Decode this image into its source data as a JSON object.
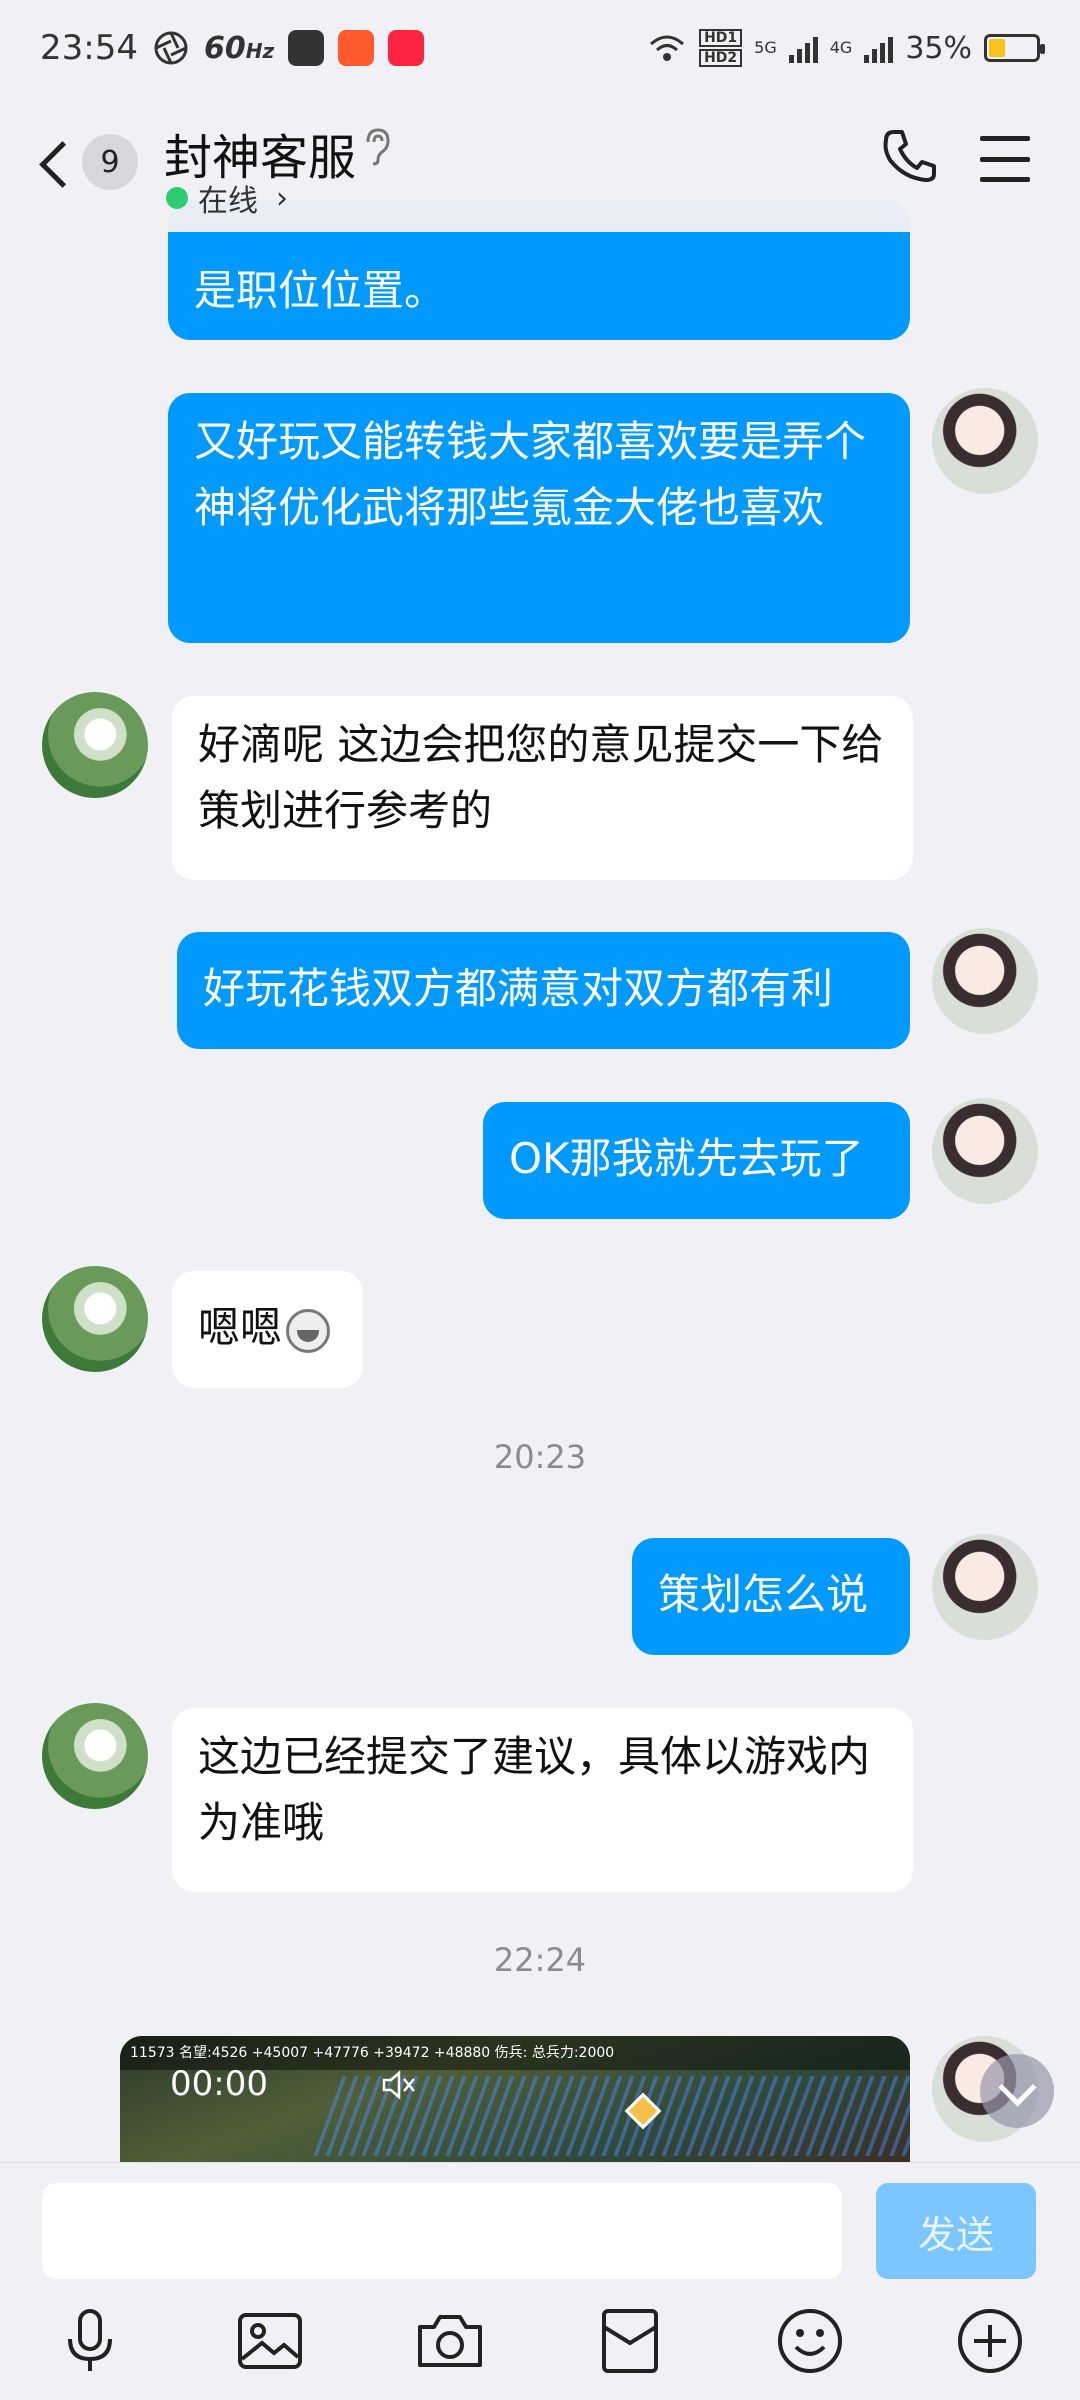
{
  "status_bar": {
    "time": "23:54",
    "refresh_rate": "60",
    "refresh_unit": "Hz",
    "hd1": "HD1",
    "hd2": "HD2",
    "net1": "5G",
    "net2": "4G",
    "battery": "35%",
    "battery_level": 0.35
  },
  "header": {
    "unread_count": "9",
    "title": "封神客服",
    "status": "在线"
  },
  "messages": [
    {
      "side": "out",
      "text_line1": "是职位位置。"
    },
    {
      "side": "out",
      "text": "又好玩又能转钱大家都喜欢要是弄个神将优化武将那些氪金大佬也喜欢"
    },
    {
      "side": "in",
      "text": "好滴呢 这边会把您的意见提交一下给策划进行参考的"
    },
    {
      "side": "out",
      "text": "好玩花钱双方都满意对双方都有利"
    },
    {
      "side": "out",
      "text": "OK那我就先去玩了"
    },
    {
      "side": "in",
      "text": "嗯嗯"
    },
    {
      "side": "time",
      "text": "20:23"
    },
    {
      "side": "out",
      "text": "策划怎么说"
    },
    {
      "side": "in",
      "text": "这边已经提交了建议，具体以游戏内为准哦"
    },
    {
      "side": "time",
      "text": "22:24"
    }
  ],
  "video": {
    "duration": "00:00",
    "hud_text": "11573 名望:4526 +45007 +47776 +39472 +48880 伤兵: 总兵力:2000"
  },
  "composer": {
    "placeholder": "",
    "send_label": "发送"
  },
  "colors": {
    "outgoing_bubble": "#0099ff",
    "incoming_bubble": "#ffffff",
    "background": "#f1f1f5",
    "send_button": "#7cc6ff"
  },
  "icons": [
    "microphone-icon",
    "image-icon",
    "camera-icon",
    "red-packet-icon",
    "emoji-icon",
    "add-icon"
  ]
}
